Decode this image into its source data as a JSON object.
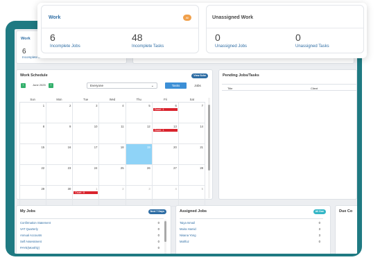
{
  "background": {
    "work_title": "Work",
    "work_count": "6",
    "work_label": "Incomplete Jo..."
  },
  "schedule": {
    "title": "Work Schedule",
    "view_all": "View Sche",
    "month": "June 2025",
    "assignee": "Everyone",
    "tab_tasks": "Tasks",
    "tab_jobs": "Jobs",
    "days": [
      "Sun",
      "Mon",
      "Tue",
      "Wed",
      "Thu",
      "Fri",
      "Sat"
    ],
    "weeks": [
      [
        "1",
        "2",
        "3",
        "4",
        "5",
        "6",
        "7"
      ],
      [
        "8",
        "9",
        "10",
        "11",
        "12",
        "13",
        "14"
      ],
      [
        "15",
        "16",
        "17",
        "18",
        "19",
        "20",
        "21"
      ],
      [
        "22",
        "23",
        "24",
        "25",
        "26",
        "27",
        "28"
      ],
      [
        "29",
        "30",
        "1",
        "2",
        "3",
        "4",
        "5"
      ]
    ],
    "events": [
      {
        "week": 0,
        "day": 5,
        "label": "Count : 1"
      },
      {
        "week": 1,
        "day": 5,
        "label": "Count : 1"
      },
      {
        "week": 4,
        "day": 2,
        "label": "Count : 8"
      }
    ],
    "today": {
      "week": 2,
      "day": 4
    }
  },
  "pending": {
    "title": "Pending Jobs/Tasks",
    "col_title": "Title",
    "col_client": "Client"
  },
  "my_jobs": {
    "title": "My Jobs",
    "button": "Next 7 Days",
    "items": [
      {
        "label": "Confirmation Statement",
        "value": "0"
      },
      {
        "label": "VAT Quarterly",
        "value": "0"
      },
      {
        "label": "Annual Accounts",
        "value": "0"
      },
      {
        "label": "Self Assessment",
        "value": "0"
      },
      {
        "label": "PAYE(Monthly)",
        "value": "0"
      }
    ]
  },
  "assigned_jobs": {
    "title": "Assigned Jobs",
    "button": "All Due",
    "items": [
      {
        "label": "Taiya Ismail",
        "value": "0"
      },
      {
        "label": "Maira Hamid",
        "value": "3"
      },
      {
        "label": "Nisana Yong",
        "value": "3"
      },
      {
        "label": "Mahfuz",
        "value": "0"
      }
    ]
  },
  "due_title": "Due Co",
  "overlay": {
    "work": {
      "title": "Work",
      "badge": "All",
      "left_count": "6",
      "left_label": "Incomplete Jobs",
      "right_count": "48",
      "right_label": "Incomplete Tasks"
    },
    "unassigned": {
      "title": "Unassigned Work",
      "left_count": "0",
      "left_label": "Unassigned Jobs",
      "right_count": "0",
      "right_label": "Unassigned Tasks"
    }
  }
}
